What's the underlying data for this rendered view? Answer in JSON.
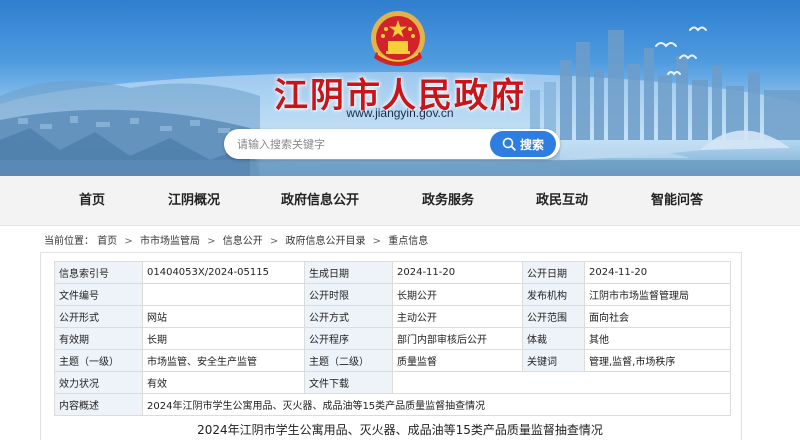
{
  "header": {
    "site_title": "江阴市人民政府",
    "site_url": "www.jiangyin.gov.cn",
    "emblem_icon": "national-emblem-icon",
    "title_color": "#c8141a"
  },
  "search": {
    "placeholder": "请输入搜索关键字",
    "button_label": "搜索",
    "button_color": "#2e7de0"
  },
  "nav": {
    "items": [
      {
        "label": "首页"
      },
      {
        "label": "江阴概况"
      },
      {
        "label": "政府信息公开"
      },
      {
        "label": "政务服务"
      },
      {
        "label": "政民互动"
      },
      {
        "label": "智能问答"
      }
    ]
  },
  "breadcrumb": {
    "prefix": "当前位置：",
    "items": [
      "首页",
      "市市场监管局",
      "信息公开",
      "政府信息公开目录",
      "重点信息"
    ],
    "separator": ">"
  },
  "info_table": {
    "rows": [
      [
        "信息索引号",
        "01404053X/2024-05115",
        "生成日期",
        "2024-11-20",
        "公开日期",
        "2024-11-20"
      ],
      [
        "文件编号",
        "",
        "公开时限",
        "长期公开",
        "发布机构",
        "江阴市市场监督管理局"
      ],
      [
        "公开形式",
        "网站",
        "公开方式",
        "主动公开",
        "公开范围",
        "面向社会"
      ],
      [
        "有效期",
        "长期",
        "公开程序",
        "部门内部审核后公开",
        "体裁",
        "其他"
      ],
      [
        "主题（一级）",
        "市场监管、安全生产监管",
        "主题（二级）",
        "质量监督",
        "关键词",
        "管理,监督,市场秩序"
      ],
      [
        "效力状况",
        "有效",
        "文件下载",
        ""
      ],
      [
        "内容概述",
        "2024年江阴市学生公寓用品、灭火器、成品油等15类产品质量监督抽查情况"
      ]
    ]
  },
  "document": {
    "title": "2024年江阴市学生公寓用品、灭火器、成品油等15类产品质量监督抽查情况"
  }
}
